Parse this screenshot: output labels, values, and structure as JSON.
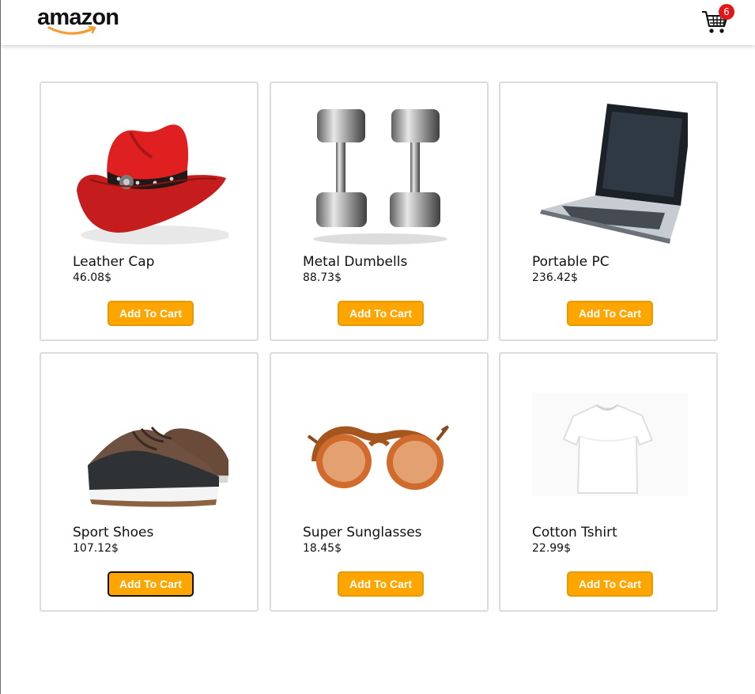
{
  "header": {
    "logo_text": "amazon",
    "cart_count": "6"
  },
  "products": [
    {
      "name": "Leather Cap",
      "price": "46.08$",
      "button": "Add To Cart"
    },
    {
      "name": "Metal Dumbells",
      "price": "88.73$",
      "button": "Add To Cart"
    },
    {
      "name": "Portable PC",
      "price": "236.42$",
      "button": "Add To Cart"
    },
    {
      "name": "Sport Shoes",
      "price": "107.12$",
      "button": "Add To Cart"
    },
    {
      "name": "Super Sunglasses",
      "price": "18.45$",
      "button": "Add To Cart"
    },
    {
      "name": "Cotton Tshirt",
      "price": "22.99$",
      "button": "Add To Cart"
    }
  ],
  "colors": {
    "button": "#ffa500",
    "badge": "#e01818",
    "logo_smile": "#f39c34"
  }
}
